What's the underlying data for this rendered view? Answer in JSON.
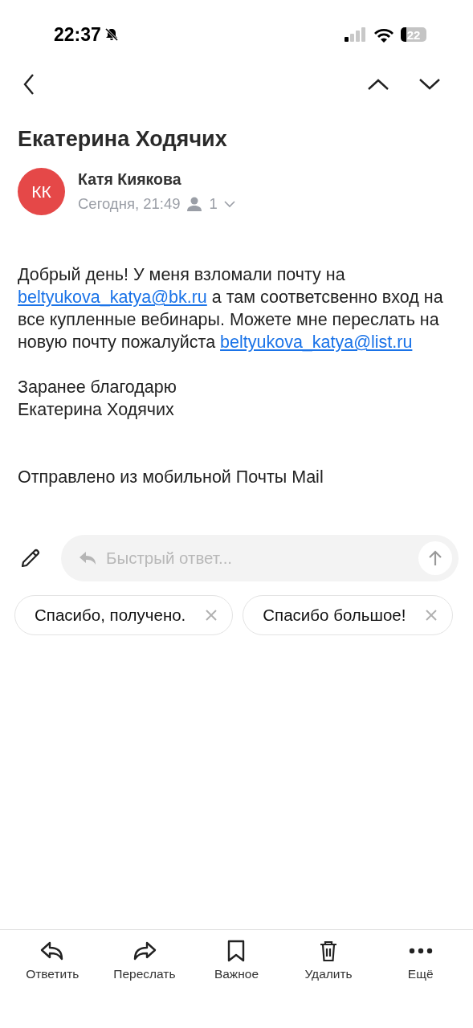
{
  "status_bar": {
    "time": "22:37",
    "battery": "22"
  },
  "subject": "Екатерина Ходячих",
  "sender": {
    "initials": "КК",
    "name": "Катя Киякова",
    "date": "Сегодня, 21:49",
    "recipients": "1"
  },
  "body": [
    [
      {
        "kind": "text",
        "text": "Добрый день! У меня взломали почту на "
      },
      {
        "kind": "link",
        "text": "beltyukova_katya@bk.ru"
      },
      {
        "kind": "text",
        "text": " а там соответсвенно вход на все купленные вебинары. Можете мне переслать на новую почту пожалуйста "
      },
      {
        "kind": "link",
        "text": "beltyukova_katya@list.ru"
      }
    ],
    [
      {
        "kind": "text",
        "text": "Заранее благодарю"
      }
    ],
    [
      {
        "kind": "text",
        "text": "Екатерина Ходячих"
      }
    ],
    [
      {
        "kind": "text",
        "text": "Отправлено из мобильной Почты Mail"
      }
    ]
  ],
  "quick_reply": {
    "placeholder": "Быстрый ответ..."
  },
  "suggestions": [
    "Спасибо, получено.",
    "Спасибо большое!"
  ],
  "toolbar": [
    {
      "kind": "reply",
      "label": "Ответить"
    },
    {
      "kind": "forward",
      "label": "Переслать"
    },
    {
      "kind": "bookmark",
      "label": "Важное"
    },
    {
      "kind": "delete",
      "label": "Удалить"
    },
    {
      "kind": "more",
      "label": "Ещё"
    }
  ]
}
